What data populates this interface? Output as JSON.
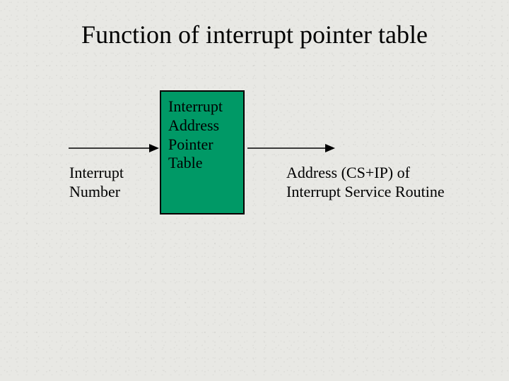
{
  "title": "Function of interrupt pointer table",
  "left_label_line1": "Interrupt",
  "left_label_line2": "Number",
  "box_line1": "Interrupt",
  "box_line2": "Address",
  "box_line3": "Pointer",
  "box_line4": "Table",
  "right_label_line1": "Address (CS+IP) of",
  "right_label_line2": "Interrupt Service Routine"
}
